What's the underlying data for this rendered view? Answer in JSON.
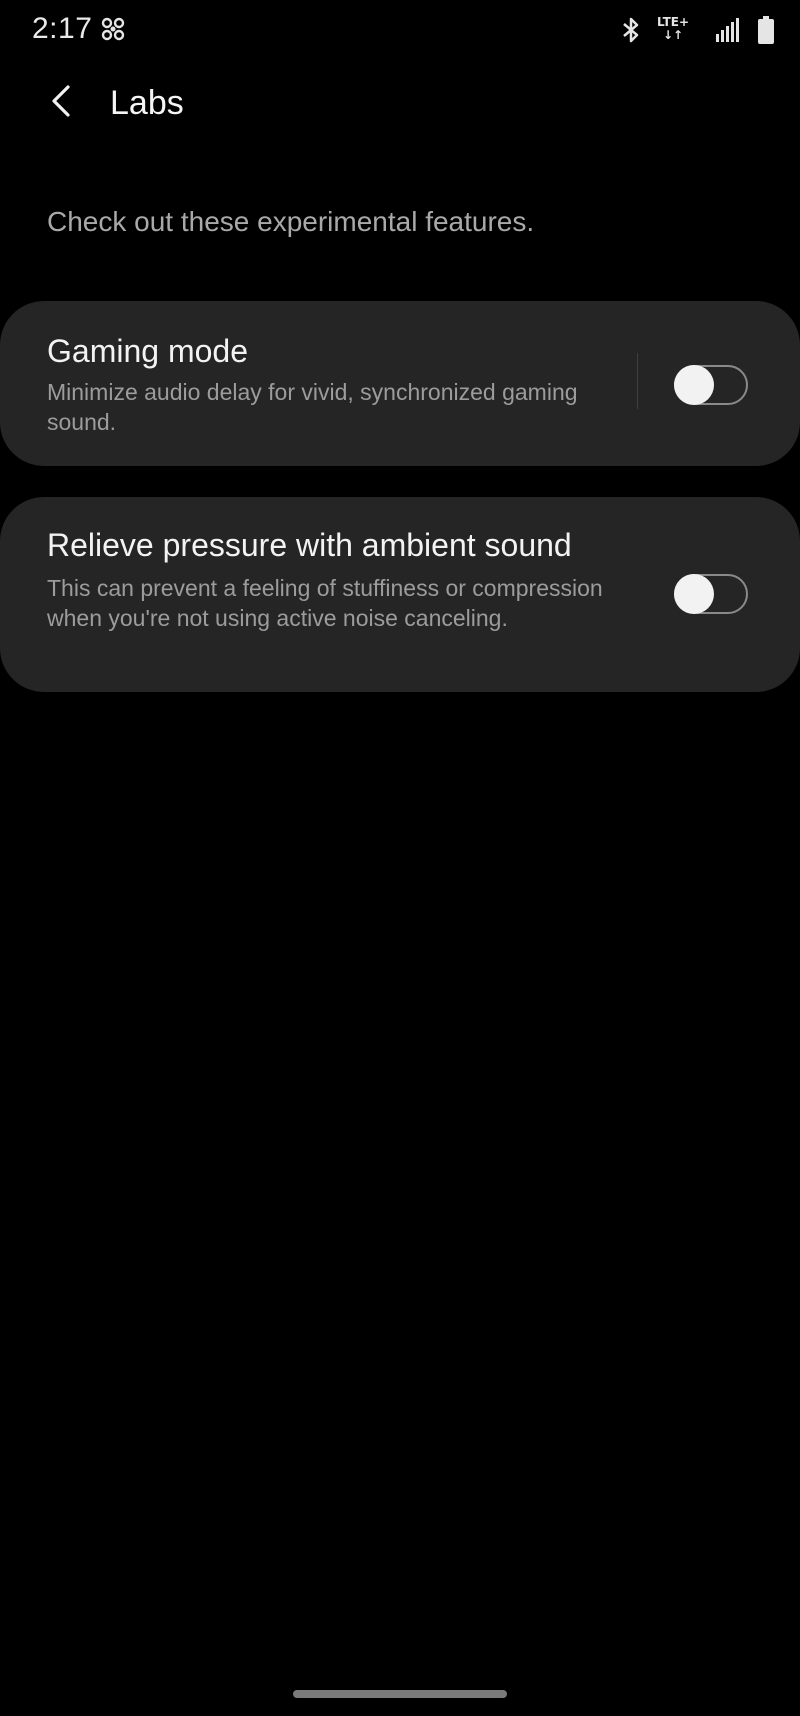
{
  "status_bar": {
    "time": "2:17",
    "left_icon": "pinwheel-icon",
    "network": "LTE+",
    "network_arrows": "↓↑",
    "icons": [
      "bluetooth-icon",
      "lte-icon",
      "signal-icon",
      "battery-icon"
    ]
  },
  "appbar": {
    "back_icon": "chevron-left-icon",
    "title": "Labs"
  },
  "intro": "Check out these experimental features.",
  "features": [
    {
      "title": "Gaming mode",
      "description": "Minimize audio delay for vivid, synchronized gaming sound.",
      "enabled": false
    },
    {
      "title": "Relieve pressure with ambient sound",
      "description": "This can prevent a feeling of stuffiness or compression when you're not using active noise canceling.",
      "enabled": false
    }
  ],
  "colors": {
    "background": "#000000",
    "card": "#252525",
    "title_text": "#f3f3f3",
    "secondary_text": "#9c9c9c"
  }
}
